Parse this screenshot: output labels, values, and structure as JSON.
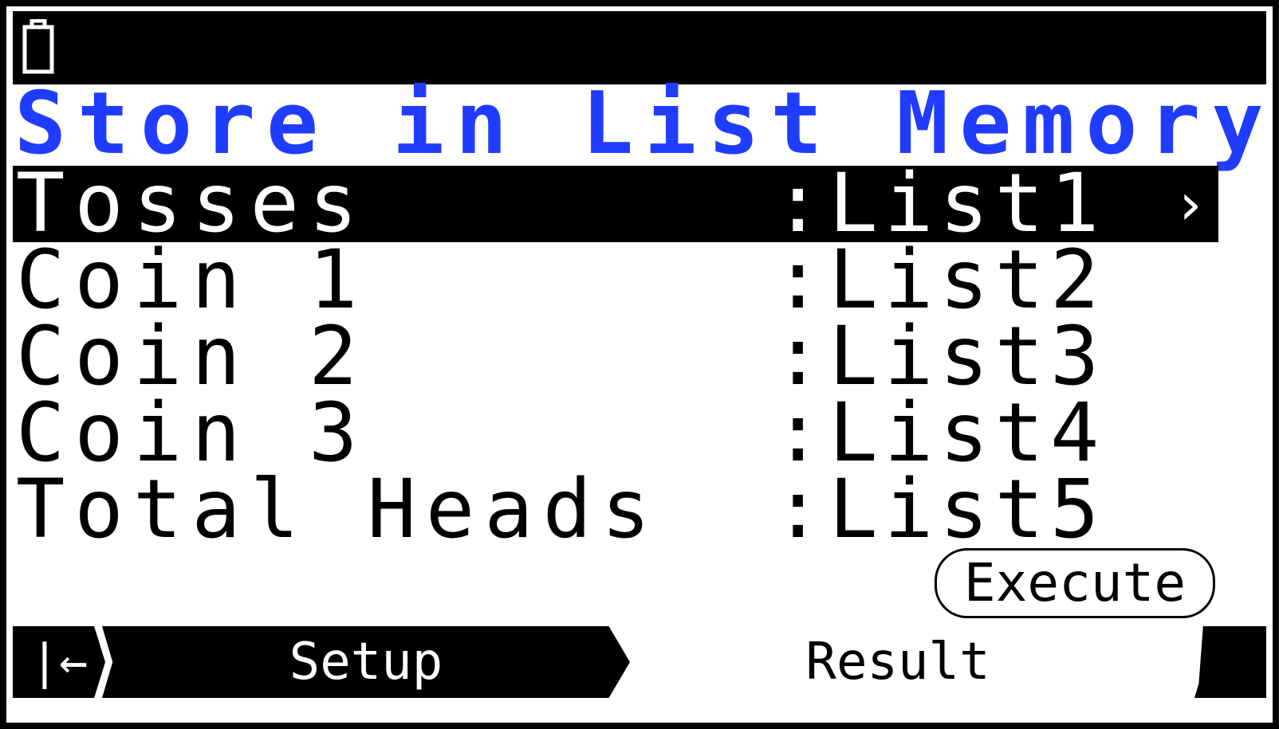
{
  "status_bar": {
    "battery_icon": "battery-icon"
  },
  "title": "Store in List Memory",
  "rows": [
    {
      "label": "Tosses",
      "value": ":List1",
      "selected": true,
      "chevron": "›"
    },
    {
      "label": "Coin 1",
      "value": ":List2",
      "selected": false
    },
    {
      "label": "Coin 2",
      "value": ":List3",
      "selected": false
    },
    {
      "label": "Coin 3",
      "value": ":List4",
      "selected": false
    },
    {
      "label": "Total Heads",
      "value": ":List5",
      "selected": false
    }
  ],
  "execute_label": "Execute",
  "tabs": {
    "back_icon": "|←",
    "setup": "Setup",
    "result": "Result"
  },
  "colors": {
    "title": "#1f3cff",
    "background": "#ffffff",
    "frame": "#000000"
  }
}
